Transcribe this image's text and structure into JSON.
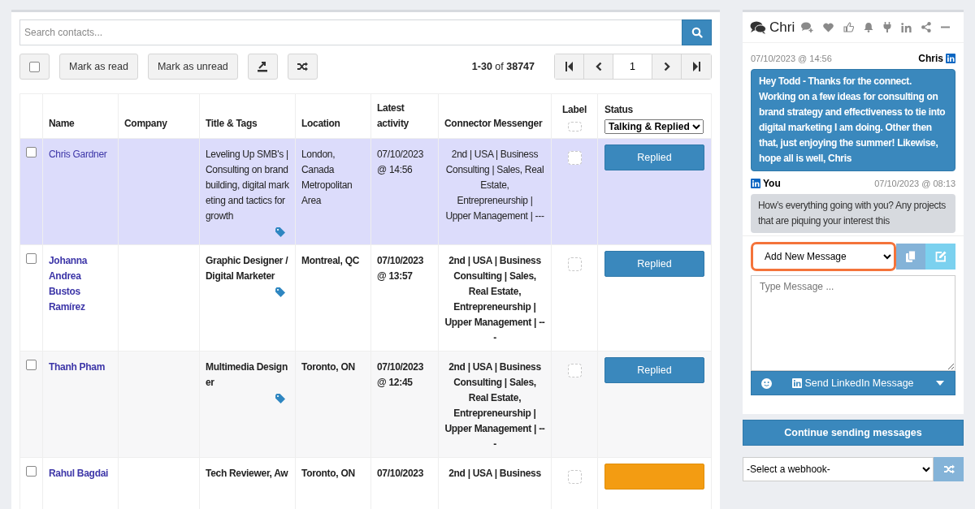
{
  "search": {
    "placeholder": "Search contacts..."
  },
  "toolbar": {
    "select_all": {
      "checked": false
    },
    "buttons": [
      "Mark as read",
      "Mark as unread"
    ]
  },
  "pagination": {
    "range": "1-30",
    "of": "of",
    "total": "38747",
    "page": "1"
  },
  "table": {
    "columns": [
      "Name",
      "Company",
      "Title & Tags",
      "Location",
      "Latest activity",
      "Connector Messenger",
      "Label",
      "Status"
    ],
    "status_filter": "Talking & Replied",
    "rows": [
      {
        "selected": true,
        "unread": false,
        "checked": false,
        "name": "Chris Gardner",
        "title": "Leveling Up SMB's | Consulting on brand building, digital marketing and tactics for growth",
        "tagged": true,
        "location": "London, Canada Metropolitan Area",
        "activity": "07/10/2023 @ 14:56",
        "connector": "2nd | USA | Business Consulting | Sales, Real Estate, Entrepreneurship | Upper Management | ---",
        "status": {
          "kind": "replied",
          "label": "Replied"
        }
      },
      {
        "selected": false,
        "unread": true,
        "checked": false,
        "name": "Johanna Andrea Bustos Ramírez",
        "title": "Graphic Designer / Digital Marketer",
        "tagged": true,
        "location": "Montreal, QC",
        "activity": "07/10/2023 @ 13:57",
        "connector": "2nd | USA | Business Consulting | Sales, Real Estate, Entrepreneurship | Upper Management | ---",
        "status": {
          "kind": "replied",
          "label": "Replied"
        }
      },
      {
        "selected": false,
        "unread": true,
        "checked": false,
        "name": "Thanh Pham",
        "title": "Multimedia Designer",
        "tagged": true,
        "location": "Toronto, ON",
        "activity": "07/10/2023 @ 12:45",
        "connector": "2nd | USA | Business Consulting | Sales, Real Estate, Entrepreneurship | Upper Management | ---",
        "status": {
          "kind": "replied",
          "label": "Replied"
        }
      },
      {
        "selected": false,
        "unread": true,
        "checked": false,
        "name": "Rahul Bagdai",
        "title": "Tech Reviewer, Aw",
        "tagged": false,
        "location": "Toronto, ON",
        "activity": "07/10/2023",
        "connector": "2nd | USA | Business",
        "status": {
          "kind": "talking"
        }
      }
    ]
  },
  "chat": {
    "title": "Chri",
    "messages": [
      {
        "kind": "incoming",
        "time": "07/10/2023 @ 14:56",
        "sender": "Chris",
        "text": "Hey Todd - Thanks for the connect. Working on a few ideas for consulting on brand strategy and effectiveness to tie into digital marketing I am doing. Other then that, just enjoying the summer! Likewise, hope all is well, Chris"
      },
      {
        "kind": "outgoing",
        "time": "07/10/2023 @ 08:13",
        "sender": "You",
        "text": "How’s everything going with you? Any projects that are piquing your interest this"
      }
    ],
    "template_select": "Add New Message",
    "message": {
      "placeholder": "Type Message ..."
    },
    "send": "Send LinkedIn Message"
  },
  "continue_button": "Continue sending messages",
  "webhook_select": "-Select a webhook-"
}
